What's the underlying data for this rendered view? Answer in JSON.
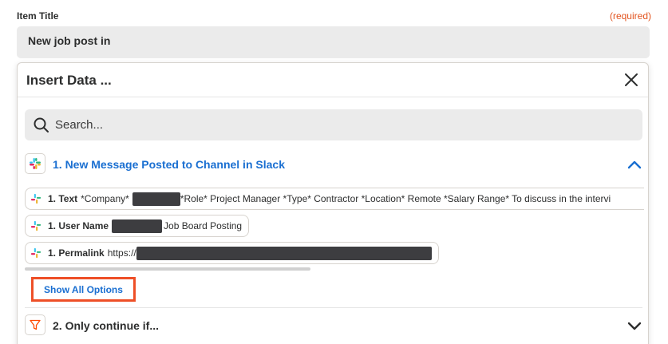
{
  "field": {
    "label": "Item Title",
    "required": "(required)",
    "value": "New job post in"
  },
  "modal": {
    "title": "Insert Data ...",
    "search_placeholder": "Search...",
    "section1": {
      "title": "1. New Message Posted to Channel in Slack",
      "items": [
        {
          "label": "1. Text",
          "value_before": "*Company*",
          "value_after": "*Role* Project Manager *Type* Contractor *Location* Remote *Salary Range* To discuss in the intervi"
        },
        {
          "label": "1. User Name",
          "value_after": "Job Board Posting"
        },
        {
          "label": "1. Permalink",
          "value_before": "https://"
        }
      ],
      "show_all": "Show All Options"
    },
    "section2": {
      "title": "2. Only continue if..."
    }
  },
  "colors": {
    "accent_blue": "#1a6fd1",
    "required_orange": "#e2541f",
    "highlight_red": "#ee4f27",
    "filter_orange": "#ff4a00"
  },
  "icons": {
    "close": "close-icon",
    "search": "search-icon",
    "slack": "slack-logo-icon",
    "chevron_up": "chevron-up-icon",
    "chevron_down": "chevron-down-icon",
    "filter": "filter-icon"
  }
}
